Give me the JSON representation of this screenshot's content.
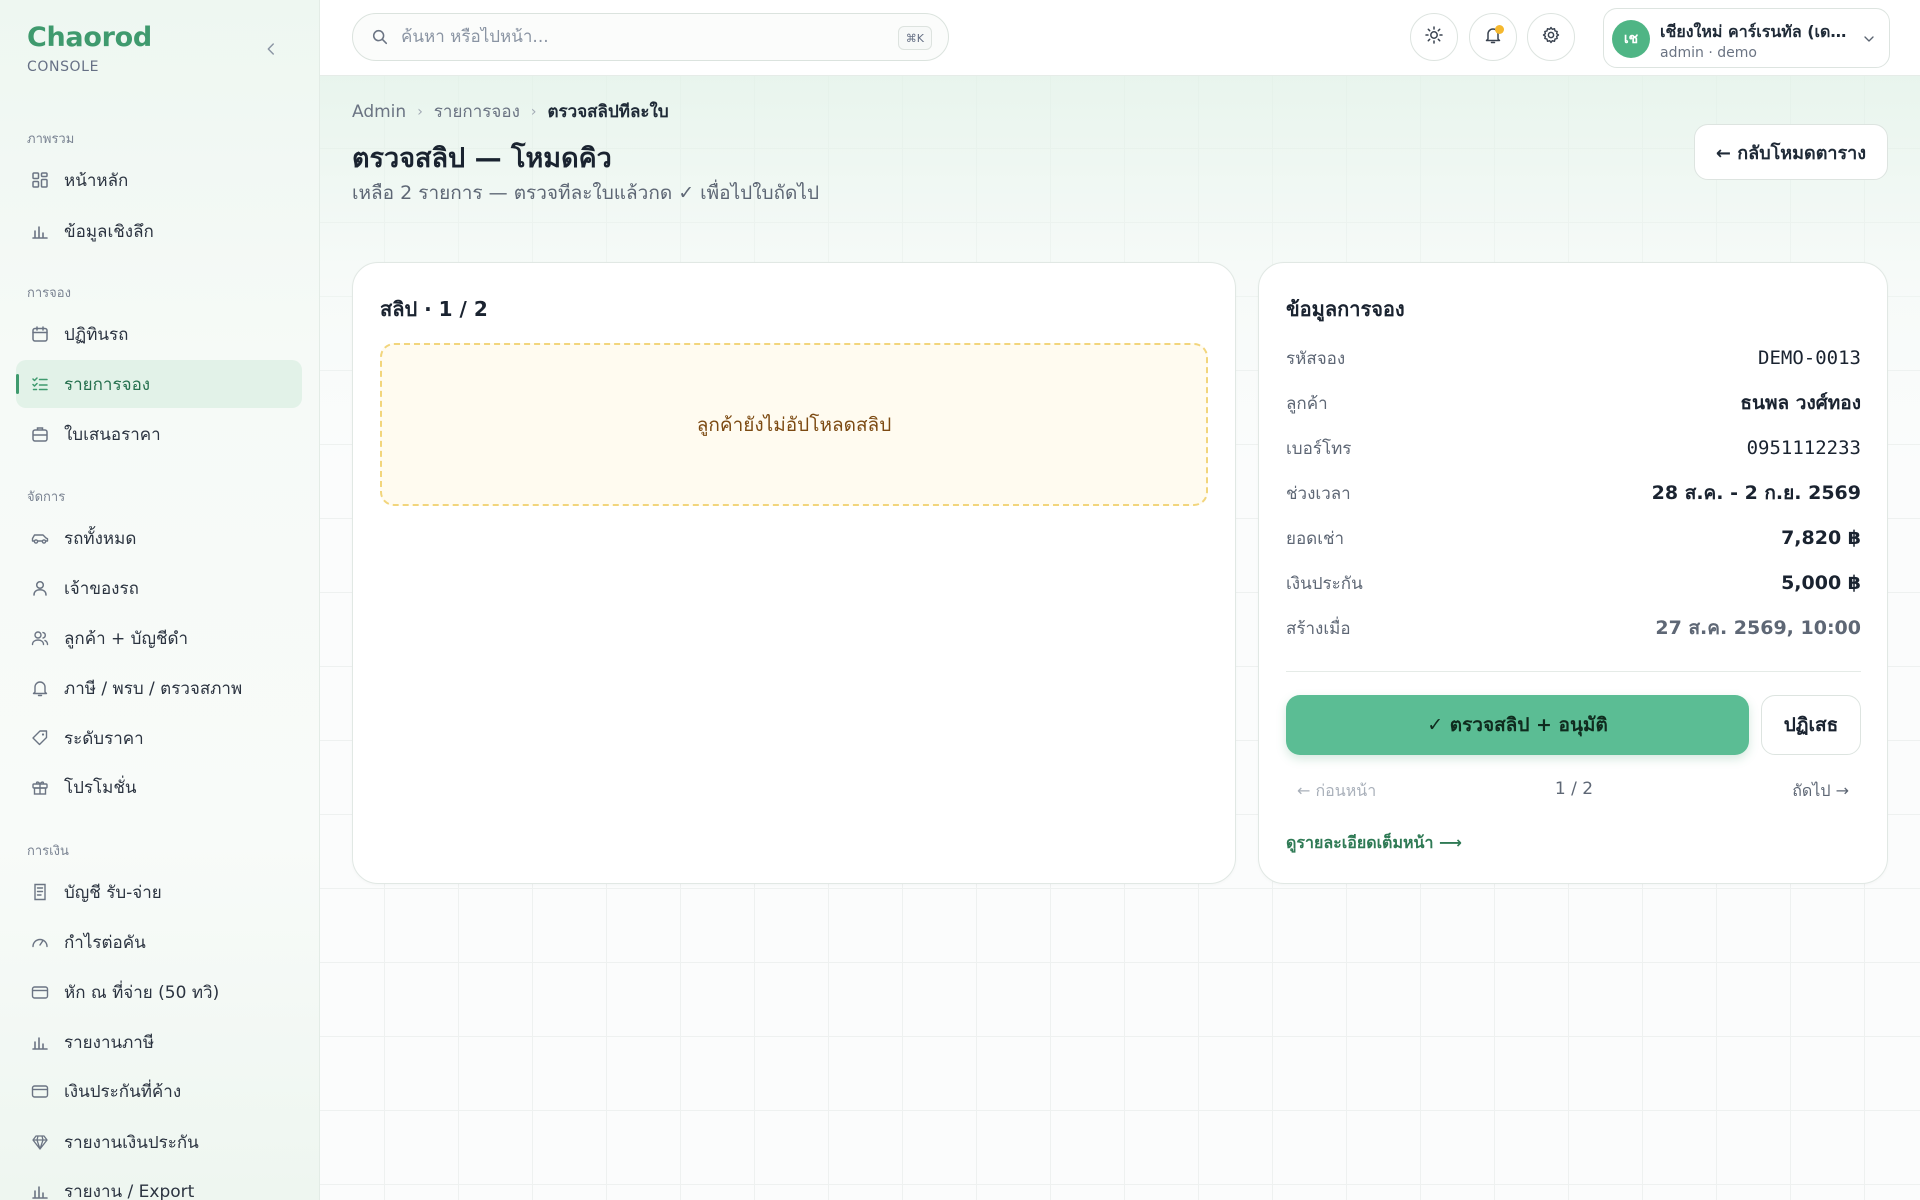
{
  "brand": {
    "name": "Chaorod",
    "sub": "CONSOLE"
  },
  "sidebar": {
    "sections": [
      {
        "label": "ภาพรวม"
      },
      {
        "label": "การจอง"
      },
      {
        "label": "จัดการ"
      },
      {
        "label": "การเงิน"
      }
    ],
    "items": [
      {
        "label": "หน้าหลัก",
        "icon": "grid-icon"
      },
      {
        "label": "ข้อมูลเชิงลึก",
        "icon": "bar-chart-icon"
      },
      {
        "label": "ปฏิทินรถ",
        "icon": "calendar-icon"
      },
      {
        "label": "รายการจอง",
        "icon": "checklist-icon",
        "active": true
      },
      {
        "label": "ใบเสนอราคา",
        "icon": "briefcase-icon"
      },
      {
        "label": "รถทั้งหมด",
        "icon": "car-icon"
      },
      {
        "label": "เจ้าของรถ",
        "icon": "user-icon"
      },
      {
        "label": "ลูกค้า + บัญชีดำ",
        "icon": "users-icon"
      },
      {
        "label": "ภาษี / พรบ / ตรวจสภาพ",
        "icon": "bell-icon"
      },
      {
        "label": "ระดับราคา",
        "icon": "tag-icon"
      },
      {
        "label": "โปรโมชั่น",
        "icon": "gift-icon"
      },
      {
        "label": "บัญชี รับ-จ่าย",
        "icon": "receipt-icon"
      },
      {
        "label": "กำไรต่อคัน",
        "icon": "gauge-icon"
      },
      {
        "label": "หัก ณ ที่จ่าย (50 ทวิ)",
        "icon": "card-icon"
      },
      {
        "label": "รายงานภาษี",
        "icon": "bar-chart-icon"
      },
      {
        "label": "เงินประกันที่ค้าง",
        "icon": "card-icon"
      },
      {
        "label": "รายงานเงินประกัน",
        "icon": "diamond-icon"
      },
      {
        "label": "รายงาน / Export",
        "icon": "bar-chart-icon"
      }
    ]
  },
  "topbar": {
    "search_placeholder": "ค้นหา หรือไปหน้า...",
    "search_shortcut": "⌘K",
    "user": {
      "initials": "เช",
      "name": "เชียงใหม่ คาร์เรนทัล (เดโม)",
      "role": "admin · demo"
    }
  },
  "breadcrumb": [
    "Admin",
    "รายการจอง",
    "ตรวจสลิปทีละใบ"
  ],
  "page": {
    "title": "ตรวจสลิป — โหมดคิว",
    "subtitle": "เหลือ 2 รายการ — ตรวจทีละใบแล้วกด ✓ เพื่อไปใบถัดไป",
    "back_label": "← กลับโหมดตาราง"
  },
  "slip": {
    "title": "สลิป · 1 / 2",
    "empty_text": "ลูกค้ายังไม่อัปโหลดสลิป"
  },
  "booking": {
    "title": "ข้อมูลการจอง",
    "rows": [
      {
        "label": "รหัสจอง",
        "value": "DEMO-0013"
      },
      {
        "label": "ลูกค้า",
        "value": "ธนพล วงศ์ทอง"
      },
      {
        "label": "เบอร์โทร",
        "value": "0951112233"
      },
      {
        "label": "ช่วงเวลา",
        "value": "28 ส.ค. - 2 ก.ย. 2569"
      },
      {
        "label": "ยอดเช่า",
        "value": "7,820 ฿"
      },
      {
        "label": "เงินประกัน",
        "value": "5,000 ฿"
      },
      {
        "label": "สร้างเมื่อ",
        "value": "27 ส.ค. 2569, 10:00"
      }
    ],
    "approve_label": "✓ ตรวจสลิป + อนุมัติ",
    "reject_label": "ปฏิเสธ",
    "pager_prev": "← ก่อนหน้า",
    "pager_count": "1 / 2",
    "pager_next": "ถัดไป →",
    "detail_link": "ดูรายละเอียดเต็มหน้า ⟶"
  },
  "colors": {
    "accent": "#3f9a6e",
    "button": "#5bbd94",
    "empty_border": "#f2d57c"
  }
}
